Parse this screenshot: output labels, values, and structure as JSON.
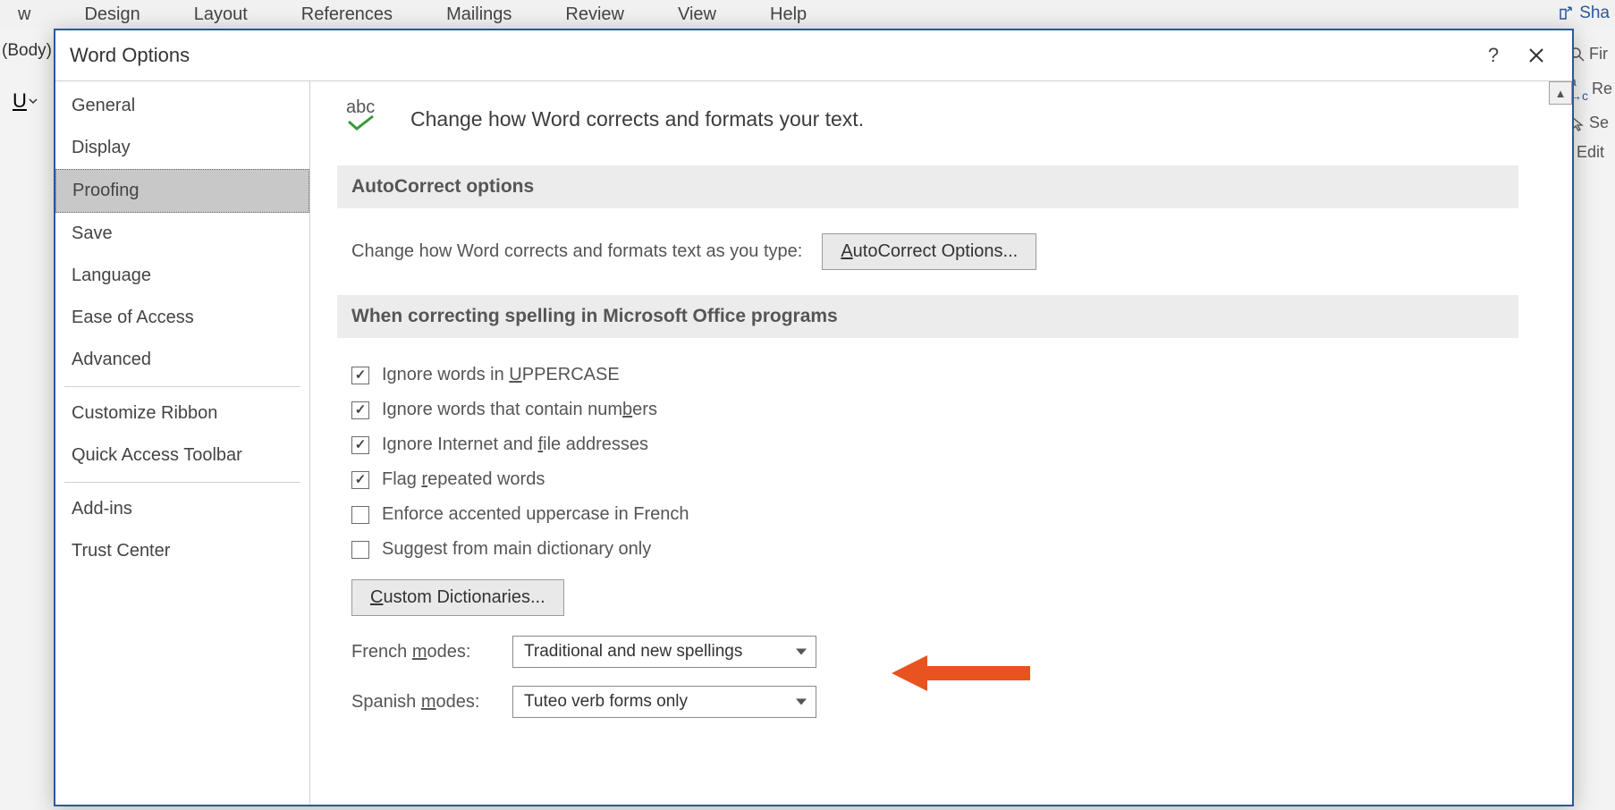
{
  "ribbon": {
    "items": [
      "w",
      "Design",
      "Layout",
      "References",
      "Mailings",
      "Review",
      "View",
      "Help"
    ],
    "share": "Sha"
  },
  "background": {
    "body_label": "(Body)",
    "underline": "U",
    "right_items": [
      "Fir",
      "Re",
      "Se",
      "Edit"
    ]
  },
  "dialog": {
    "title": "Word Options"
  },
  "sidebar": {
    "g1": [
      "General",
      "Display",
      "Proofing",
      "Save",
      "Language",
      "Ease of Access",
      "Advanced"
    ],
    "g2": [
      "Customize Ribbon",
      "Quick Access Toolbar"
    ],
    "g3": [
      "Add-ins",
      "Trust Center"
    ],
    "selected": "Proofing"
  },
  "content": {
    "hero_icon_text": "abc",
    "hero_text": "Change how Word corrects and formats your text.",
    "section_autocorrect": "AutoCorrect options",
    "autocorrect_line": "Change how Word corrects and formats text as you type:",
    "autocorrect_btn_pre": "",
    "autocorrect_btn_u": "A",
    "autocorrect_btn_post": "utoCorrect Options...",
    "section_spelling": "When correcting spelling in Microsoft Office programs",
    "checks": [
      {
        "checked": true,
        "pre": "Ignore words in ",
        "u": "U",
        "post": "PPERCASE"
      },
      {
        "checked": true,
        "pre": "Ignore words that contain num",
        "u": "b",
        "post": "ers"
      },
      {
        "checked": true,
        "pre": "Ignore Internet and ",
        "u": "f",
        "post": "ile addresses"
      },
      {
        "checked": true,
        "pre": "Flag ",
        "u": "r",
        "post": "epeated words"
      },
      {
        "checked": false,
        "pre": "Enforce accented uppercase in French",
        "u": "",
        "post": ""
      },
      {
        "checked": false,
        "pre": "Suggest from main dictionary only",
        "u": "",
        "post": ""
      }
    ],
    "custom_dict_u": "C",
    "custom_dict_post": "ustom Dictionaries...",
    "french_label_pre": "French ",
    "french_label_u": "m",
    "french_label_post": "odes:",
    "french_value": "Traditional and new spellings",
    "spanish_label_pre": "Spanish ",
    "spanish_label_u": "m",
    "spanish_label_post": "odes:",
    "spanish_value": "Tuteo verb forms only"
  }
}
